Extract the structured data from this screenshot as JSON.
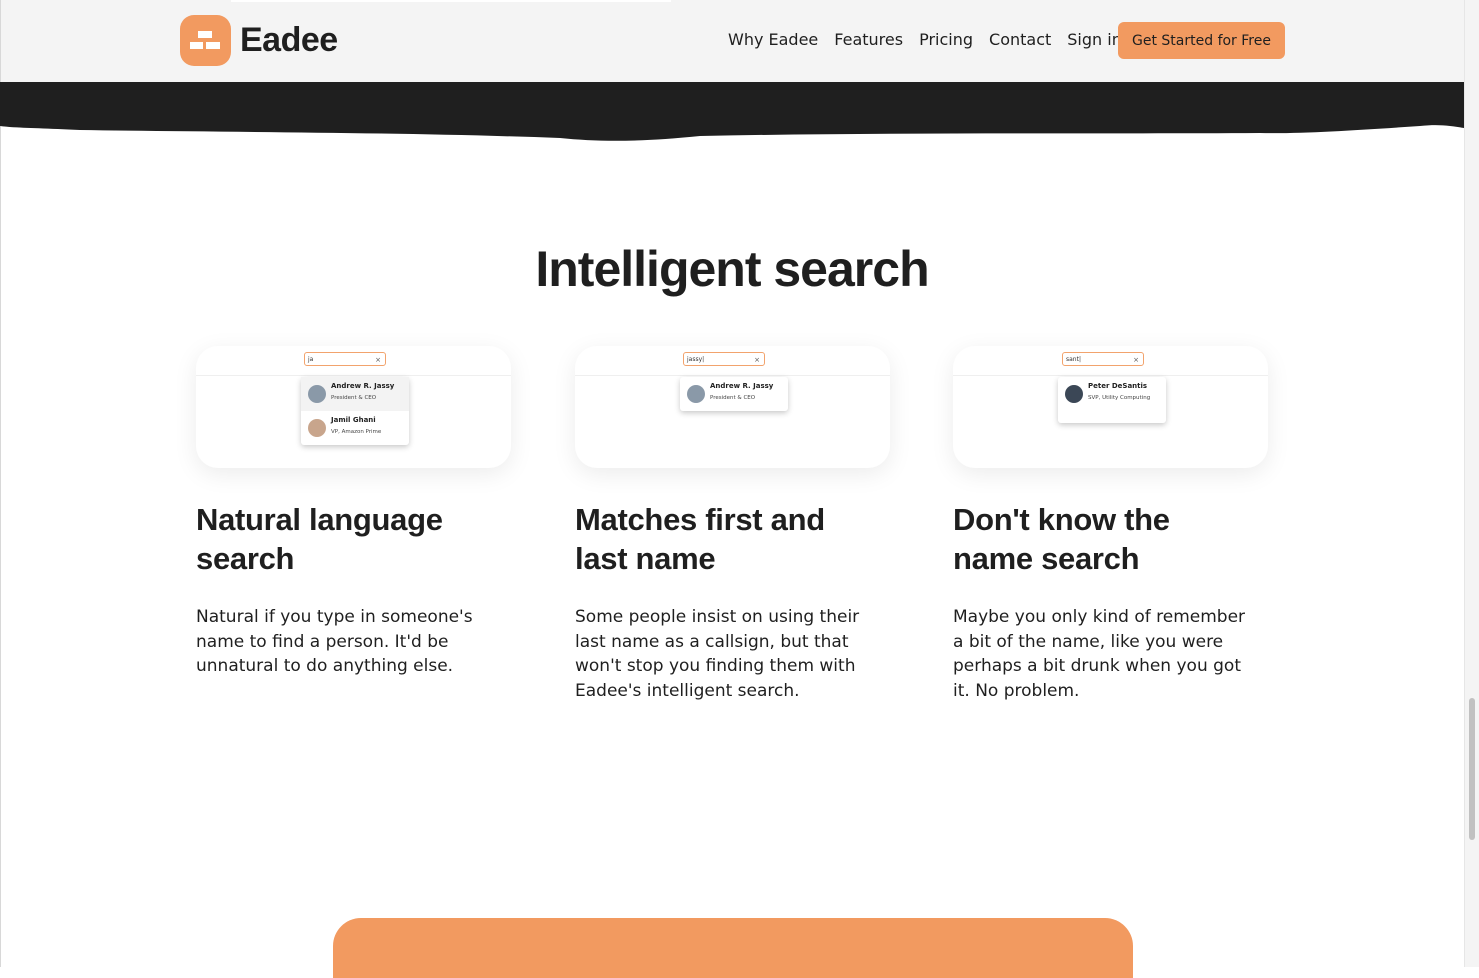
{
  "brand": {
    "name": "Eadee",
    "accent": "#f29a60"
  },
  "nav": {
    "links": [
      "Why Eadee",
      "Features",
      "Pricing",
      "Contact",
      "Sign in"
    ],
    "cta": "Get Started for Free"
  },
  "section": {
    "title": "Intelligent search"
  },
  "features": [
    {
      "title": "Natural language search",
      "body": "Natural if you type in someone's name to find a person. It'd be unnatural to do anything else.",
      "query": "ja",
      "results": [
        {
          "name": "Andrew R. Jassy",
          "role": "President & CEO"
        },
        {
          "name": "Jamil Ghani",
          "role": "VP, Amazon Prime"
        }
      ]
    },
    {
      "title": "Matches first and last name",
      "body": "Some people insist on using their last name as a callsign, but that won't stop you finding them with Eadee's intelligent search.",
      "query": "jassy|",
      "results": [
        {
          "name": "Andrew R. Jassy",
          "role": "President & CEO"
        }
      ]
    },
    {
      "title": "Don't know the name search",
      "body": "Maybe you only kind of remember a bit of the name, like you were perhaps a bit drunk when you got it. No problem.",
      "query": "sant|",
      "results": [
        {
          "name": "Peter DeSantis",
          "role": "SVP, Utility Computing"
        }
      ]
    }
  ],
  "icons": {
    "clear": "×"
  }
}
